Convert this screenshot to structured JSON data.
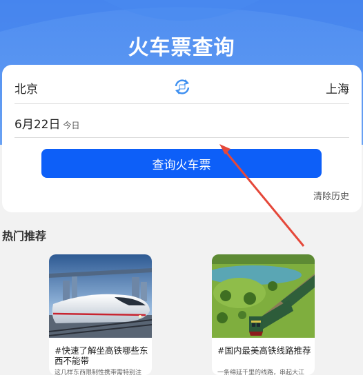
{
  "header": {
    "title": "火车票查询"
  },
  "search": {
    "from_station": "北京",
    "to_station": "上海",
    "date": "6月22日",
    "date_tag": "今日",
    "button_label": "查询火车票",
    "clear_history": "清除历史"
  },
  "recommend": {
    "title": "热门推荐",
    "cards": [
      {
        "title": "#快速了解坐高铁哪些东西不能带",
        "desc": "这几样东西限制性携带需特别注"
      },
      {
        "title": "#国内最美高铁线路推荐",
        "desc": "一条绵延千里的线路，串起大江"
      }
    ]
  },
  "colors": {
    "accent": "#0d5ff8",
    "header": "#5b97f2",
    "annotation_arrow": "#e5483a"
  },
  "icons": {
    "swap": "swap-stations-icon"
  }
}
